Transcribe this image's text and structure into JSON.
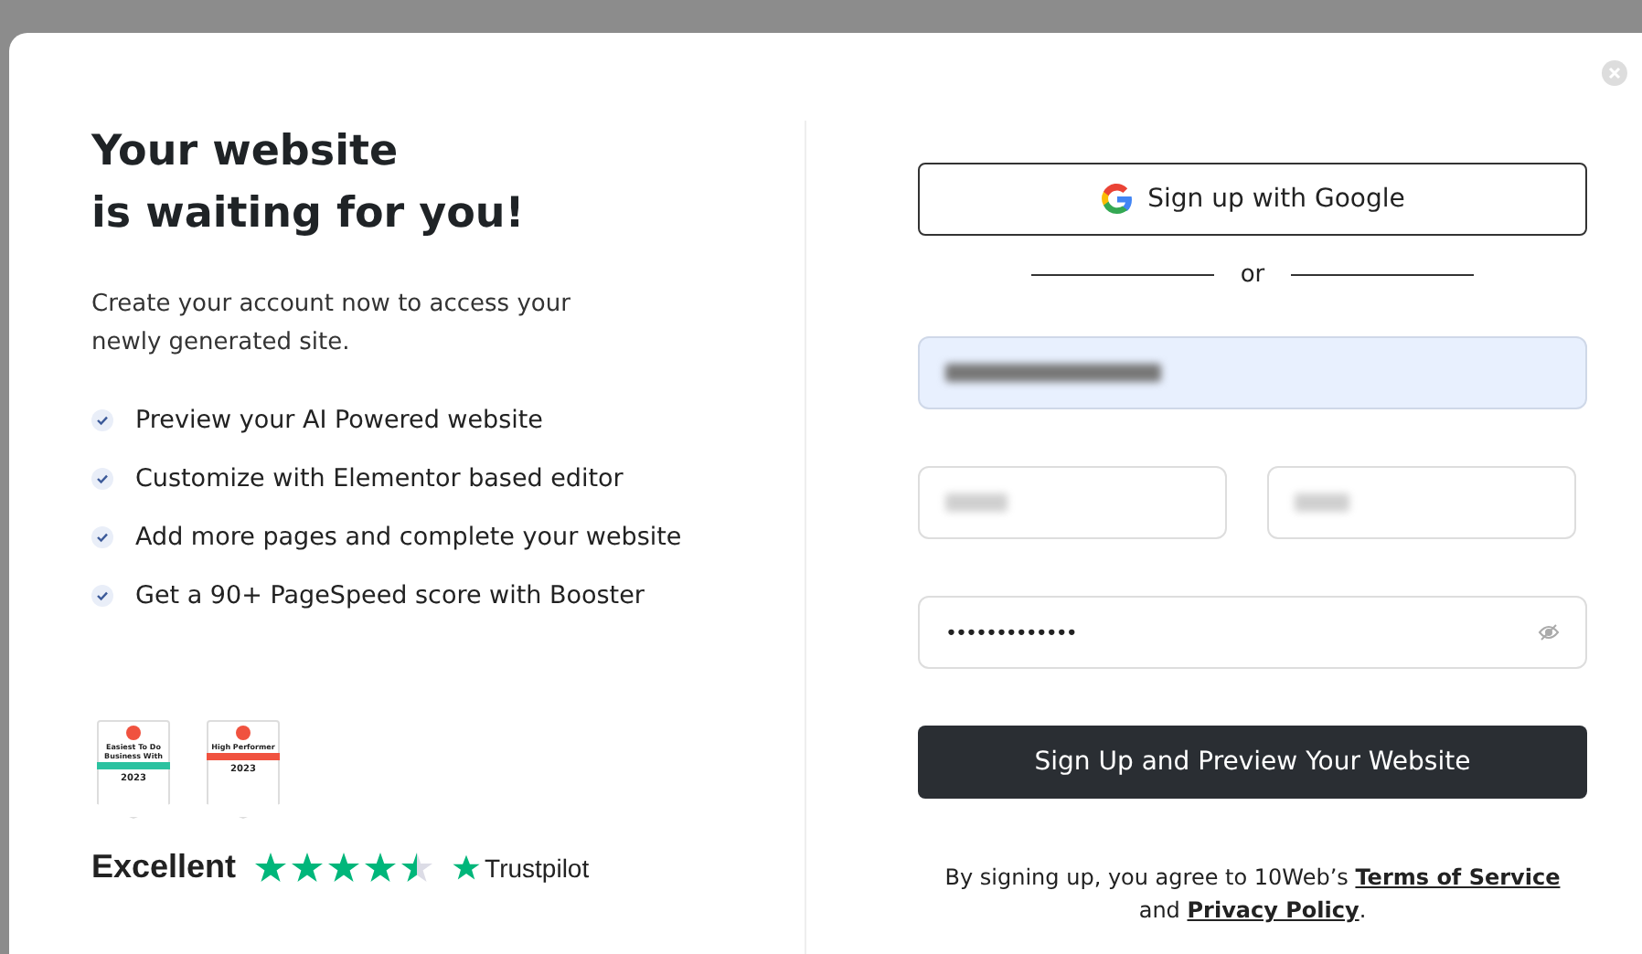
{
  "dialog": {
    "title": "Your website\nis waiting for you!",
    "description": "Create your account now to access your newly generated site.",
    "benefits": [
      {
        "label": "Preview your AI Powered website"
      },
      {
        "label": "Customize with Elementor based editor"
      },
      {
        "label": "Add more pages and complete your website"
      },
      {
        "label": "Get a 90+ PageSpeed score with Booster"
      }
    ],
    "badges": [
      {
        "caption": "Easiest To Do Business With",
        "year": "2023",
        "color": "#2bc2a0"
      },
      {
        "caption": "High Performer",
        "year": "2023",
        "color": "#f0523f"
      }
    ],
    "rating": {
      "label": "Excellent",
      "stars": 4.5,
      "brand": "Trustpilot"
    },
    "google_button": "Sign up with Google",
    "divider": "or",
    "fields": [
      {
        "kind": "email"
      },
      {
        "kind": "first_name"
      },
      {
        "kind": "last_name"
      },
      {
        "kind": "password",
        "value": "•••••••••••••"
      }
    ],
    "submit_button": "Sign Up and Preview Your Website",
    "terms": {
      "prefix": "By signing up, you agree to 10Web’s",
      "terms_link": "Terms of Service",
      "middle": "and",
      "privacy_link": "Privacy Policy",
      "suffix": "."
    }
  }
}
